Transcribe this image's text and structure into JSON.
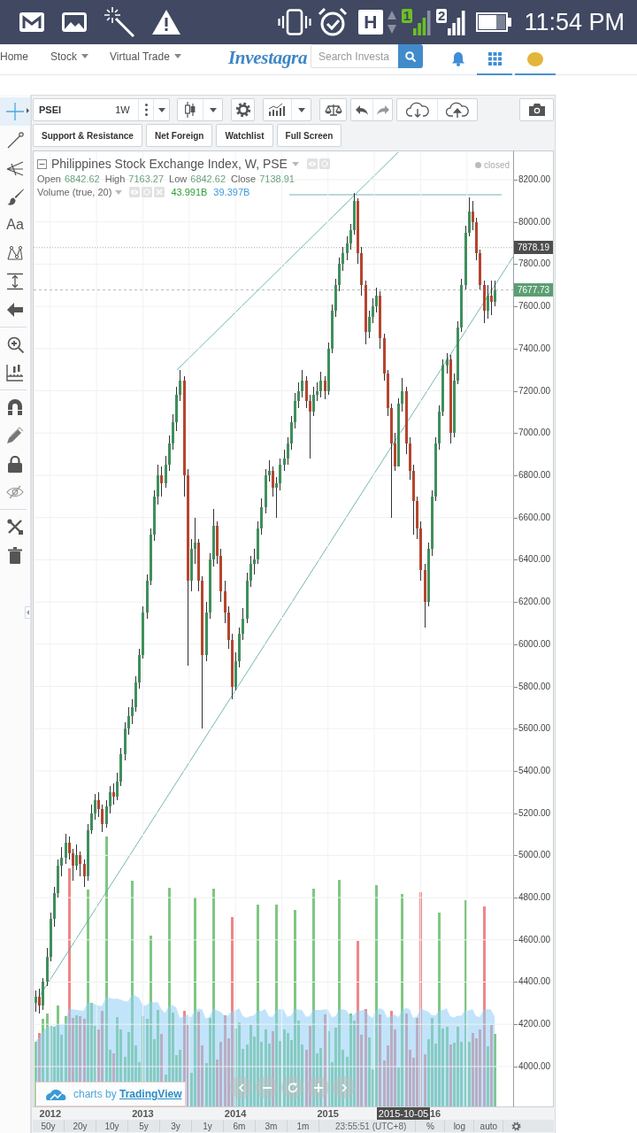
{
  "status_bar": {
    "network_type": "H",
    "sims": [
      {
        "label": "1",
        "active": true
      },
      {
        "label": "2",
        "active": false
      }
    ],
    "time": "11:54 PM"
  },
  "nav": {
    "links": [
      {
        "label": "Home",
        "dropdown": false
      },
      {
        "label": "Stock",
        "dropdown": true
      },
      {
        "label": "Virtual Trade",
        "dropdown": true
      }
    ],
    "logo": "Investagra",
    "search": {
      "placeholder": "Search Investa"
    },
    "icons": [
      {
        "kind": "bell",
        "selected": false
      },
      {
        "kind": "apps",
        "selected": true
      },
      {
        "kind": "avatar",
        "selected": true
      }
    ]
  },
  "left_toolbar": {
    "groups": [
      [
        {
          "kind": "crosshair",
          "selected": true
        },
        {
          "kind": "trend-line",
          "selected": false
        },
        {
          "kind": "pitchfork",
          "selected": false
        },
        {
          "kind": "brush",
          "selected": false
        },
        {
          "kind": "text",
          "label": "Aa",
          "selected": false
        },
        {
          "kind": "pattern",
          "selected": false
        },
        {
          "kind": "measure",
          "selected": false
        },
        {
          "kind": "arrow",
          "selected": false
        }
      ],
      [
        {
          "kind": "zoom",
          "selected": false
        },
        {
          "kind": "ruler",
          "selected": false
        }
      ],
      [
        {
          "kind": "magnet",
          "selected": false
        },
        {
          "kind": "stay-drawing",
          "selected": false
        },
        {
          "kind": "lock",
          "selected": false
        },
        {
          "kind": "hide",
          "selected": false
        }
      ],
      [
        {
          "kind": "remove",
          "selected": false
        },
        {
          "kind": "trash",
          "selected": false
        }
      ]
    ]
  },
  "toolbar": {
    "symbol": "PSEI",
    "interval": "1W"
  },
  "quick_buttons": [
    "Support & Resistance",
    "Net Foreign",
    "Watchlist",
    "Full Screen"
  ],
  "chart": {
    "legend": {
      "title": "Philippines Stock Exchange Index, W, PSE",
      "ohlc": [
        {
          "label": "Open",
          "value": "6842.62"
        },
        {
          "label": "High",
          "value": "7163.27"
        },
        {
          "label": "Low",
          "value": "6842.62"
        },
        {
          "label": "Close",
          "value": "7138.91"
        }
      ],
      "volume": {
        "label": "Volume (true, 20)",
        "values": [
          {
            "text": "43.991B",
            "color": "#2e9e3a"
          },
          {
            "text": "39.397B",
            "color": "#3b9be0"
          }
        ]
      }
    },
    "market_status": "closed",
    "chart_data": {
      "type": "candlestick",
      "xlim": [
        2011.82,
        2017.0
      ],
      "ylim": [
        3811,
        8334
      ],
      "grid": true,
      "ref_lines": [
        {
          "axis": "y",
          "value": 7878.19
        },
        {
          "axis": "y",
          "value": 7677.73
        }
      ],
      "x": [
        2011.84,
        2011.88,
        2011.92,
        2011.96,
        2012,
        2012.04,
        2012.08,
        2012.12,
        2012.16,
        2012.2,
        2012.24,
        2012.28,
        2012.32,
        2012.36,
        2012.4,
        2012.44,
        2012.48,
        2012.52,
        2012.56,
        2012.6,
        2012.64,
        2012.68,
        2012.72,
        2012.76,
        2012.8,
        2012.84,
        2012.88,
        2012.92,
        2012.96,
        2013,
        2013.04,
        2013.08,
        2013.12,
        2013.16,
        2013.2,
        2013.24,
        2013.28,
        2013.32,
        2013.36,
        2013.4,
        2013.44,
        2013.48,
        2013.52,
        2013.56,
        2013.6,
        2013.64,
        2013.68,
        2013.72,
        2013.76,
        2013.8,
        2013.84,
        2013.88,
        2013.92,
        2013.96,
        2014,
        2014.04,
        2014.08,
        2014.12,
        2014.16,
        2014.2,
        2014.24,
        2014.28,
        2014.32,
        2014.36,
        2014.4,
        2014.44,
        2014.48,
        2014.52,
        2014.56,
        2014.6,
        2014.64,
        2014.68,
        2014.72,
        2014.76,
        2014.8,
        2014.84,
        2014.88,
        2014.92,
        2014.96,
        2015,
        2015.04,
        2015.08,
        2015.12,
        2015.16,
        2015.2,
        2015.24,
        2015.28,
        2015.32,
        2015.36,
        2015.4,
        2015.44,
        2015.48,
        2015.52,
        2015.56,
        2015.6,
        2015.64,
        2015.68,
        2015.72,
        2015.76,
        2015.8,
        2015.84,
        2015.88,
        2015.92,
        2015.96,
        2016,
        2016.04,
        2016.08,
        2016.12,
        2016.16,
        2016.2,
        2016.24,
        2016.28,
        2016.32,
        2016.36,
        2016.4,
        2016.44,
        2016.48,
        2016.52,
        2016.56,
        2016.6,
        2016.64,
        2016.68,
        2016.72,
        2016.76,
        2016.8
      ],
      "ohlc": [
        [
          4300,
          4360,
          4260,
          4330
        ],
        [
          4330,
          4370,
          4250,
          4290
        ],
        [
          4290,
          4420,
          4270,
          4400
        ],
        [
          4400,
          4560,
          4380,
          4520
        ],
        [
          4520,
          4730,
          4500,
          4700
        ],
        [
          4700,
          4850,
          4660,
          4820
        ],
        [
          4820,
          4980,
          4800,
          4950
        ],
        [
          4950,
          5040,
          4900,
          4990
        ],
        [
          4990,
          5100,
          4960,
          5060
        ],
        [
          5060,
          5090,
          4980,
          5010
        ],
        [
          5010,
          5030,
          4880,
          4950
        ],
        [
          4950,
          5050,
          4930,
          5000
        ],
        [
          5000,
          5020,
          4900,
          4960
        ],
        [
          4960,
          4980,
          4850,
          4900
        ],
        [
          4900,
          5150,
          4880,
          5120
        ],
        [
          5120,
          5240,
          5100,
          5200
        ],
        [
          5200,
          5290,
          5170,
          5260
        ],
        [
          5260,
          5300,
          5180,
          5220
        ],
        [
          5220,
          5240,
          5110,
          5150
        ],
        [
          5150,
          5260,
          5130,
          5230
        ],
        [
          5230,
          5330,
          5200,
          5300
        ],
        [
          5300,
          5340,
          5240,
          5280
        ],
        [
          5280,
          5390,
          5260,
          5350
        ],
        [
          5350,
          5510,
          5330,
          5480
        ],
        [
          5480,
          5630,
          5450,
          5600
        ],
        [
          5600,
          5700,
          5570,
          5660
        ],
        [
          5660,
          5740,
          5620,
          5700
        ],
        [
          5700,
          5850,
          5680,
          5820
        ],
        [
          5820,
          5980,
          5790,
          5950
        ],
        [
          5950,
          6180,
          5930,
          6150
        ],
        [
          6150,
          6330,
          6120,
          6300
        ],
        [
          6300,
          6550,
          6280,
          6520
        ],
        [
          6520,
          6730,
          6490,
          6700
        ],
        [
          6700,
          6850,
          6660,
          6800
        ],
        [
          6800,
          6840,
          6700,
          6760
        ],
        [
          6760,
          6890,
          6740,
          6850
        ],
        [
          6850,
          6990,
          6820,
          6950
        ],
        [
          6950,
          7090,
          6920,
          7050
        ],
        [
          7050,
          7220,
          7010,
          7180
        ],
        [
          7180,
          7300,
          7150,
          7250
        ],
        [
          7250,
          7270,
          6700,
          6800
        ],
        [
          6800,
          6830,
          5900,
          6300
        ],
        [
          6300,
          6500,
          6250,
          6450
        ],
        [
          6450,
          6600,
          6380,
          6480
        ],
        [
          6480,
          6500,
          6250,
          6300
        ],
        [
          6300,
          6320,
          5600,
          5950
        ],
        [
          5950,
          6200,
          5920,
          6150
        ],
        [
          6150,
          6430,
          6120,
          6400
        ],
        [
          6400,
          6640,
          6370,
          6560
        ],
        [
          6560,
          6580,
          6380,
          6420
        ],
        [
          6420,
          6450,
          6200,
          6250
        ],
        [
          6250,
          6300,
          6100,
          6150
        ],
        [
          6150,
          6180,
          5980,
          6020
        ],
        [
          6020,
          6050,
          5740,
          5800
        ],
        [
          5800,
          5960,
          5780,
          5920
        ],
        [
          5920,
          6080,
          5890,
          6050
        ],
        [
          6050,
          6170,
          6020,
          6120
        ],
        [
          6120,
          6340,
          6100,
          6300
        ],
        [
          6300,
          6420,
          6270,
          6380
        ],
        [
          6380,
          6450,
          6330,
          6400
        ],
        [
          6400,
          6580,
          6380,
          6550
        ],
        [
          6550,
          6690,
          6520,
          6650
        ],
        [
          6650,
          6830,
          6620,
          6800
        ],
        [
          6800,
          6870,
          6770,
          6820
        ],
        [
          6820,
          6840,
          6700,
          6740
        ],
        [
          6740,
          6790,
          6600,
          6760
        ],
        [
          6760,
          6880,
          6730,
          6850
        ],
        [
          6850,
          6920,
          6820,
          6880
        ],
        [
          6880,
          6980,
          6850,
          6950
        ],
        [
          6950,
          7080,
          6920,
          7050
        ],
        [
          7050,
          7190,
          7020,
          7150
        ],
        [
          7150,
          7240,
          7120,
          7200
        ],
        [
          7200,
          7300,
          7170,
          7250
        ],
        [
          7250,
          7270,
          7120,
          7150
        ],
        [
          7150,
          7180,
          6880,
          7100
        ],
        [
          7100,
          7220,
          7080,
          7180
        ],
        [
          7180,
          7240,
          7150,
          7200
        ],
        [
          7200,
          7290,
          7170,
          7250
        ],
        [
          7250,
          7270,
          7160,
          7200
        ],
        [
          7200,
          7430,
          7180,
          7400
        ],
        [
          7400,
          7610,
          7380,
          7580
        ],
        [
          7580,
          7730,
          7550,
          7700
        ],
        [
          7700,
          7830,
          7670,
          7800
        ],
        [
          7800,
          7880,
          7770,
          7850
        ],
        [
          7850,
          7930,
          7820,
          7900
        ],
        [
          7900,
          7990,
          7870,
          7960
        ],
        [
          7960,
          8136,
          7940,
          8100
        ],
        [
          8100,
          8110,
          7800,
          7850
        ],
        [
          7850,
          7880,
          7650,
          7700
        ],
        [
          7700,
          7720,
          7420,
          7480
        ],
        [
          7480,
          7580,
          7450,
          7550
        ],
        [
          7550,
          7640,
          7520,
          7600
        ],
        [
          7600,
          7690,
          7570,
          7650
        ],
        [
          7650,
          7670,
          7400,
          7450
        ],
        [
          7450,
          7470,
          7250,
          7280
        ],
        [
          7280,
          7300,
          7080,
          7120
        ],
        [
          7120,
          7140,
          6600,
          6950
        ],
        [
          6950,
          7000,
          6820,
          6842.62
        ],
        [
          6842.62,
          7163.27,
          6842.62,
          7138.91
        ],
        [
          7138.91,
          7260,
          7100,
          7200
        ],
        [
          7200,
          7220,
          6900,
          6950
        ],
        [
          6950,
          6980,
          6780,
          6820
        ],
        [
          6820,
          6850,
          6520,
          6680
        ],
        [
          6680,
          6700,
          6500,
          6550
        ],
        [
          6550,
          6580,
          6300,
          6350
        ],
        [
          6350,
          6380,
          6080,
          6200
        ],
        [
          6200,
          6480,
          6180,
          6450
        ],
        [
          6450,
          6730,
          6420,
          6700
        ],
        [
          6700,
          6980,
          6680,
          6950
        ],
        [
          6950,
          7130,
          6920,
          7100
        ],
        [
          7100,
          7350,
          7080,
          7320
        ],
        [
          7320,
          7380,
          7280,
          7350
        ],
        [
          7350,
          7370,
          6950,
          7000
        ],
        [
          7000,
          7280,
          6980,
          7250
        ],
        [
          7250,
          7530,
          7230,
          7500
        ],
        [
          7500,
          7730,
          7480,
          7700
        ],
        [
          7700,
          7980,
          7680,
          7950
        ],
        [
          7950,
          8118,
          7930,
          8050
        ],
        [
          8050,
          8100,
          7960,
          8000
        ],
        [
          8000,
          8020,
          7820,
          7850
        ],
        [
          7850,
          7870,
          7680,
          7700
        ],
        [
          7700,
          7720,
          7520,
          7580
        ],
        [
          7580,
          7700,
          7540,
          7650
        ],
        [
          7650,
          7720,
          7560,
          7620
        ],
        [
          7620,
          7720,
          7600,
          7677.73
        ]
      ],
      "xticks": [
        {
          "value": 2012,
          "label": "2012"
        },
        {
          "value": 2013,
          "label": "2013"
        },
        {
          "value": 2014,
          "label": "2014"
        },
        {
          "value": 2015,
          "label": "2015"
        }
      ],
      "yticks": [
        {
          "value": 8200,
          "label": "8200.00"
        },
        {
          "value": 8000,
          "label": "8000.00"
        },
        {
          "value": 7800,
          "label": "7800.00"
        },
        {
          "value": 7600,
          "label": "7600.00"
        },
        {
          "value": 7400,
          "label": "7400.00"
        },
        {
          "value": 7200,
          "label": "7200.00"
        },
        {
          "value": 7000,
          "label": "7000.00"
        },
        {
          "value": 6800,
          "label": "6800.00"
        },
        {
          "value": 6600,
          "label": "6600.00"
        },
        {
          "value": 6400,
          "label": "6400.00"
        },
        {
          "value": 6200,
          "label": "6200.00"
        },
        {
          "value": 6000,
          "label": "6000.00"
        },
        {
          "value": 5800,
          "label": "5800.00"
        },
        {
          "value": 5600,
          "label": "5600.00"
        },
        {
          "value": 5400,
          "label": "5400.00"
        },
        {
          "value": 5200,
          "label": "5200.00"
        },
        {
          "value": 5000,
          "label": "5000.00"
        },
        {
          "value": 4800,
          "label": "4800.00"
        },
        {
          "value": 4600,
          "label": "4600.00"
        },
        {
          "value": 4400,
          "label": "4400.00"
        },
        {
          "value": 4200,
          "label": "4200.00"
        },
        {
          "value": 4000,
          "label": "4000.00"
        }
      ]
    },
    "price_axis": {
      "markers": [
        {
          "value": "7878.19",
          "kind": "crosshair"
        },
        {
          "value": "7677.73",
          "kind": "last"
        }
      ]
    },
    "time_axis": {
      "cursor": "2015-10-05",
      "cut_label": "16"
    },
    "attribution": {
      "text": "charts by",
      "link": "TradingView"
    }
  },
  "range_bar": {
    "ranges": [
      "50y",
      "20y",
      "10y",
      "5y",
      "3y",
      "1y",
      "6m",
      "3m",
      "1m"
    ],
    "clock": "23:55:51 (UTC+8)",
    "options": [
      "%",
      "log",
      "auto"
    ]
  }
}
